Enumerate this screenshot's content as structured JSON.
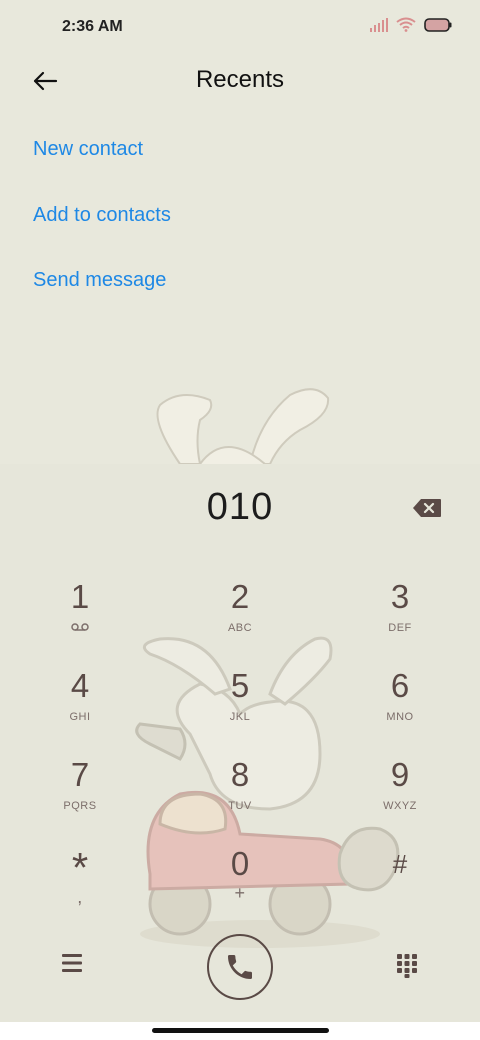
{
  "status_bar": {
    "time": "2:36 AM",
    "icons": [
      "signal-icon",
      "wifi-icon",
      "battery-icon"
    ]
  },
  "header": {
    "title": "Recents",
    "back_icon": "arrow-left-icon"
  },
  "menu": [
    {
      "label": "New contact"
    },
    {
      "label": "Add to contacts"
    },
    {
      "label": "Send message"
    }
  ],
  "dialer": {
    "number": "010",
    "keys": [
      {
        "digit": "1",
        "letters": "",
        "sub_icon": "voicemail-icon"
      },
      {
        "digit": "2",
        "letters": "ABC"
      },
      {
        "digit": "3",
        "letters": "DEF"
      },
      {
        "digit": "4",
        "letters": "GHI"
      },
      {
        "digit": "5",
        "letters": "JKL"
      },
      {
        "digit": "6",
        "letters": "MNO"
      },
      {
        "digit": "7",
        "letters": "PQRS"
      },
      {
        "digit": "8",
        "letters": "TUV"
      },
      {
        "digit": "9",
        "letters": "WXYZ"
      },
      {
        "digit": "*",
        "letters": ","
      },
      {
        "digit": "0",
        "letters": "+"
      },
      {
        "digit": "#",
        "letters": ""
      }
    ]
  },
  "colors": {
    "background": "#e8e8dc",
    "link": "#1e88e5",
    "keypad_text": "#5a4a46"
  }
}
